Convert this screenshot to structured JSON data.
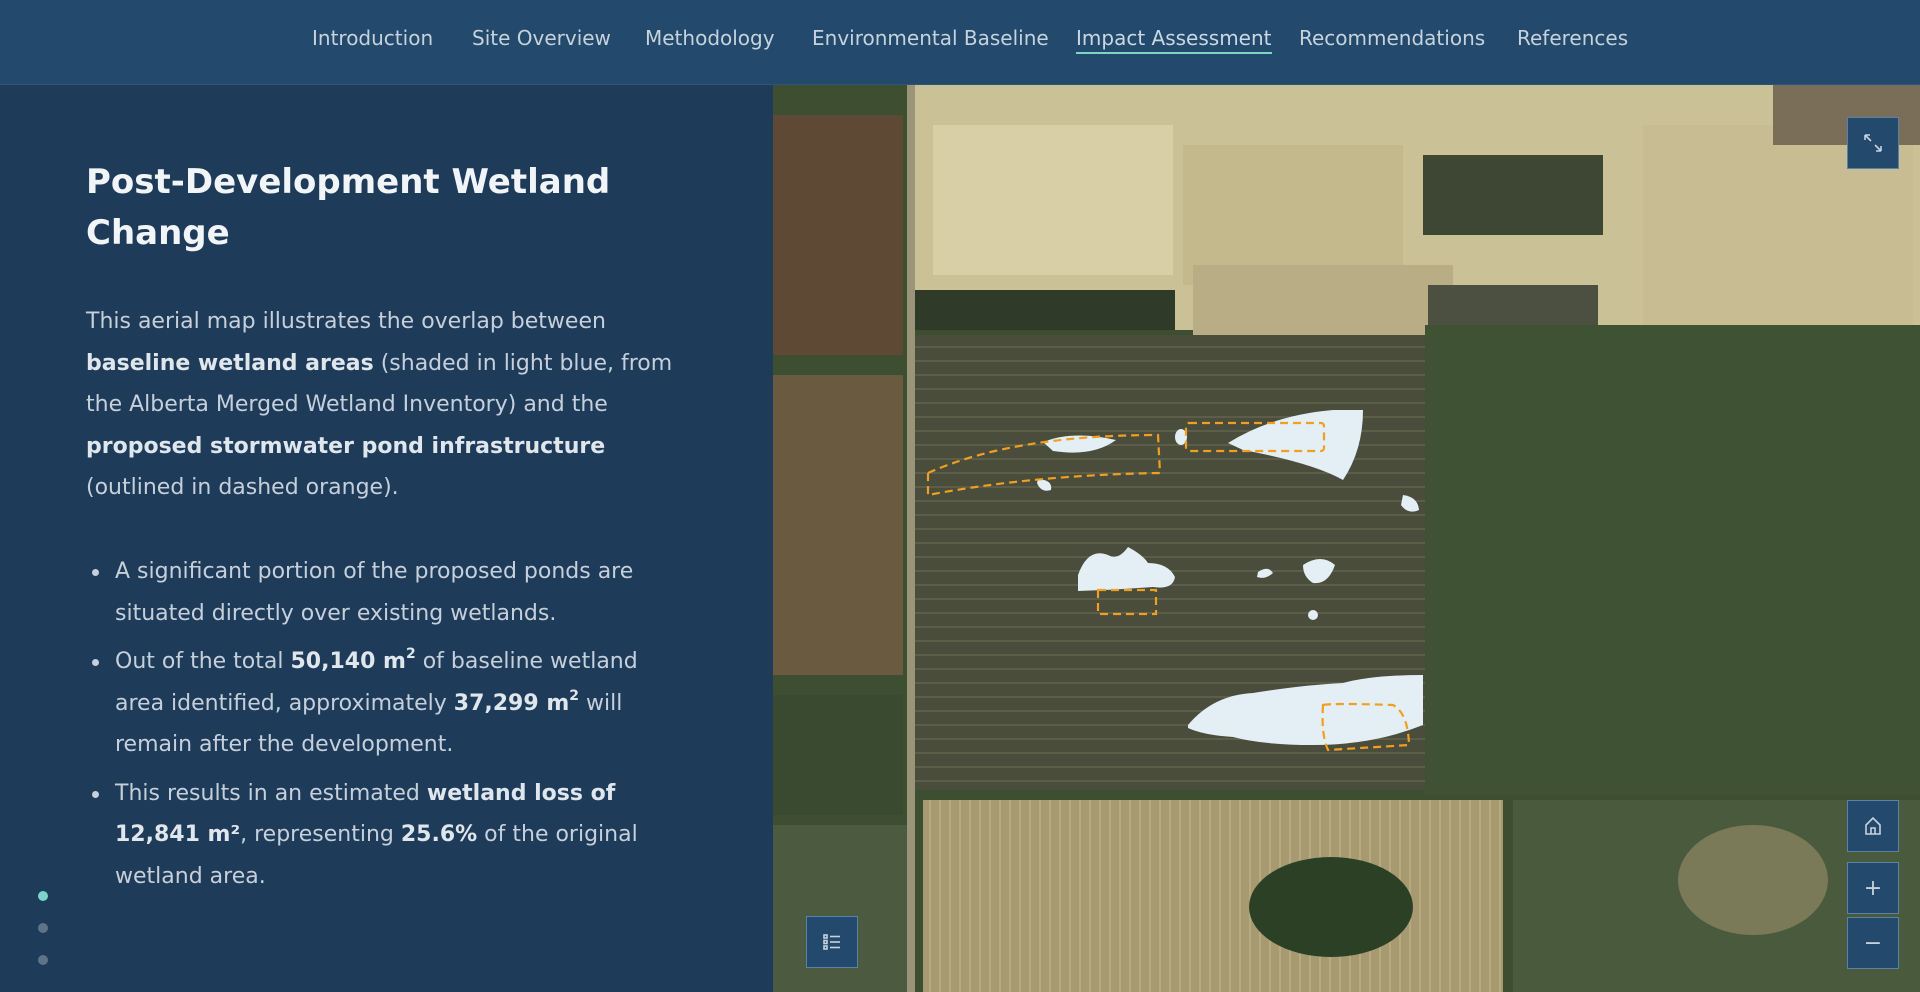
{
  "nav": {
    "items": [
      {
        "label": "Introduction"
      },
      {
        "label": "Site Overview"
      },
      {
        "label": "Methodology"
      },
      {
        "label": "Environmental Baseline"
      },
      {
        "label": "Impact Assessment",
        "active": true
      },
      {
        "label": "Recommendations"
      },
      {
        "label": "References"
      }
    ]
  },
  "content": {
    "title": "Post-Development Wetland Change",
    "intro": {
      "part1": "This aerial map illustrates the overlap between ",
      "bold1": "baseline wetland areas",
      "part2": " (shaded in light blue, from the Alberta Merged Wetland Inventory) and the ",
      "bold2": "proposed stormwater pond infrastructure",
      "part3": " (outlined in dashed orange)."
    },
    "bullets": {
      "b1": "A significant portion of the proposed ponds are situated directly over existing wetlands.",
      "b2_pre": "Out of the total ",
      "b2_total": "50,140 m",
      "b2_mid": " of baseline wetland area identified, approximately ",
      "b2_remain": "37,299 m",
      "b2_post": " will remain after the development.",
      "sup": "2",
      "b3_pre": "This results in an estimated ",
      "b3_bold": "wetland loss of 12,841 m²",
      "b3_mid": ", representing ",
      "b3_pct": "25.6%",
      "b3_post": " of the original wetland area."
    }
  },
  "pagination": {
    "total": 3,
    "active_index": 0
  },
  "map": {
    "colors": {
      "wetland_fill": "#e3eef5",
      "pond_outline": "#f0a020",
      "panel_bg": "#1f3b5a",
      "nav_bg": "#23496c",
      "accent": "#7fd4c7"
    },
    "controls": {
      "fullscreen_icon": "expand-arrows-icon",
      "home_icon": "home-icon",
      "zoom_in_label": "+",
      "zoom_out_label": "−",
      "legend_icon": "list-icon"
    }
  }
}
